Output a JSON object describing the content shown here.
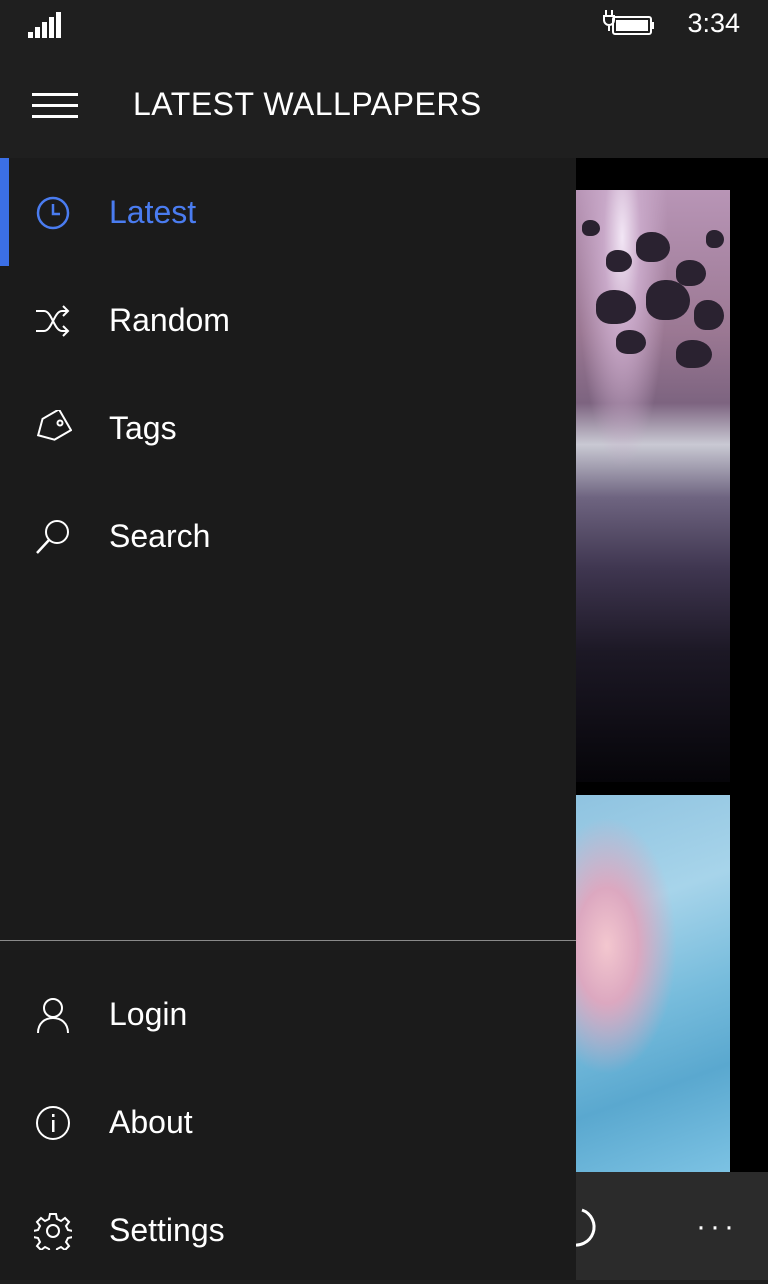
{
  "status": {
    "time": "3:34",
    "signal_icon": "signal-bars-icon",
    "battery_icon": "battery-charging-icon"
  },
  "header": {
    "title": "LATEST WALLPAPERS",
    "menu_icon": "hamburger-icon"
  },
  "colors": {
    "accent": "#3b6fe6",
    "accent_text": "#4a7cf0",
    "pane_bg": "#1b1b1b"
  },
  "nav": {
    "items": [
      {
        "label": "Latest",
        "icon": "clock-icon",
        "selected": true
      },
      {
        "label": "Random",
        "icon": "shuffle-icon"
      },
      {
        "label": "Tags",
        "icon": "tag-icon"
      },
      {
        "label": "Search",
        "icon": "search-icon"
      }
    ],
    "bottom_items": [
      {
        "label": "Login",
        "icon": "person-icon"
      },
      {
        "label": "About",
        "icon": "info-icon"
      },
      {
        "label": "Settings",
        "icon": "gear-icon"
      }
    ]
  },
  "appbar": {
    "more_label": "···",
    "refresh_icon": "refresh-icon"
  }
}
